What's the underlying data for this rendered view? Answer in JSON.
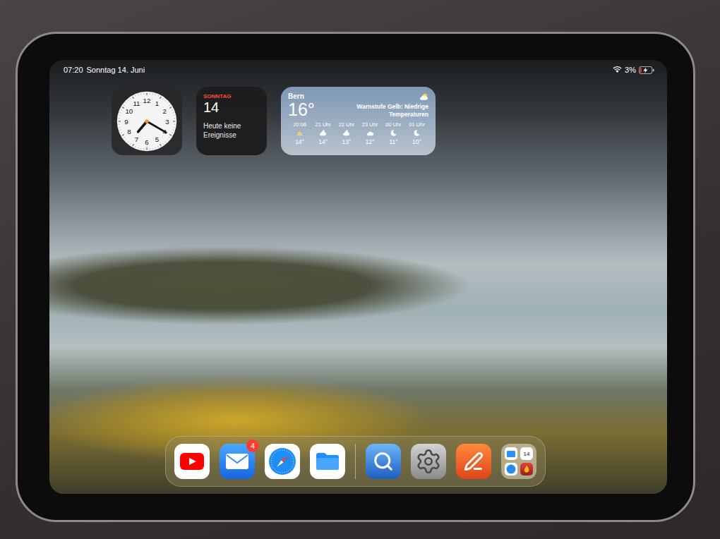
{
  "status_bar": {
    "time": "07:20",
    "date": "Sonntag 14. Juni",
    "battery": "3%",
    "charging": true,
    "wifi": true
  },
  "clock_widget": {
    "hour": 7,
    "minute": 20,
    "numerals": [
      "12",
      "1",
      "2",
      "3",
      "4",
      "5",
      "6",
      "7",
      "8",
      "9",
      "10",
      "11"
    ]
  },
  "calendar_widget": {
    "weekday": "SONNTAG",
    "day": "14",
    "events": "Heute keine Ereignisse"
  },
  "weather_widget": {
    "city": "Bern",
    "temperature": "16°",
    "condition_kind": "cloud-sun",
    "warning": "Warnstufe Gelb: Niedrige Temperaturen",
    "hours": [
      {
        "time": "20:06",
        "kind": "sunset",
        "temp": "14°"
      },
      {
        "time": "21 Uhr",
        "kind": "cloud-moon",
        "temp": "14°"
      },
      {
        "time": "22 Uhr",
        "kind": "cloud-moon",
        "temp": "13°"
      },
      {
        "time": "23 Uhr",
        "kind": "cloud",
        "temp": "12°"
      },
      {
        "time": "00 Uhr",
        "kind": "moon",
        "temp": "11°"
      },
      {
        "time": "01 Uhr",
        "kind": "moon",
        "temp": "10°"
      }
    ]
  },
  "dock": {
    "apps": [
      {
        "kind": "youtube"
      },
      {
        "kind": "mail",
        "badge": "4"
      },
      {
        "kind": "safari"
      },
      {
        "kind": "files"
      }
    ],
    "recent": [
      {
        "kind": "preview"
      },
      {
        "kind": "settings"
      },
      {
        "kind": "pages"
      },
      {
        "kind": "folder",
        "items": [
          {
            "kind": "files"
          },
          {
            "kind": "calendar",
            "label": "14"
          },
          {
            "kind": "safari"
          },
          {
            "kind": "photobooth"
          }
        ]
      }
    ]
  }
}
